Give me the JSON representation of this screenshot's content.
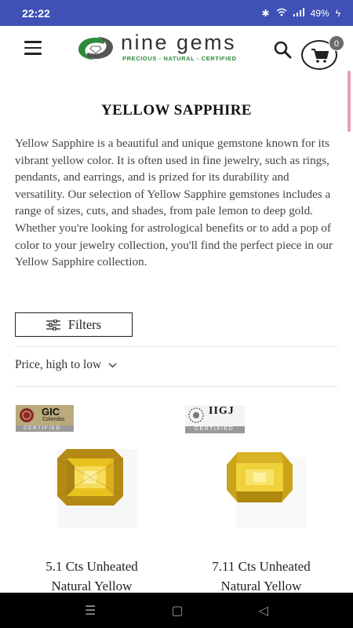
{
  "status": {
    "time": "22:22",
    "battery": "49%"
  },
  "header": {
    "brand": "nine gems",
    "tagline": "PRECIOUS - NATURAL - CERTIFIED",
    "cart_count": "0",
    "icons": [
      "menu-icon",
      "search-icon",
      "cart-icon"
    ]
  },
  "page": {
    "title": "YELLOW SAPPHIRE",
    "description": "Yellow Sapphire is a beautiful and unique gemstone known for its vibrant yellow color. It is often used in fine jewelry, such as rings, pendants, and earrings, and is prized for its durability and versatility. Our selection of Yellow Sapphire gemstones includes a range of sizes, cuts, and shades, from pale lemon to deep gold. Whether you're looking for astrological benefits or to add a pop of color to your jewelry collection, you'll find the perfect piece in our Yellow Sapphire collection."
  },
  "toolbar": {
    "filters_label": "Filters",
    "sort_label": "Price, high to low"
  },
  "products": [
    {
      "certificate_lab": "GIC",
      "certificate_sub": "Colombo",
      "certificate_label": "CERTIFIED",
      "title_line1": "5.1 Cts Unheated",
      "title_line2": "Natural Yellow"
    },
    {
      "certificate_lab": "IIGJ",
      "certificate_sub": "",
      "certificate_label": "CERTIFIED",
      "title_line1": "7.11 Cts Unheated",
      "title_line2": "Natural Yellow"
    }
  ],
  "colors": {
    "status_bar": "#3f51b5",
    "brand_green": "#2d8a3a",
    "gem_yellow": "#e8c21e"
  }
}
